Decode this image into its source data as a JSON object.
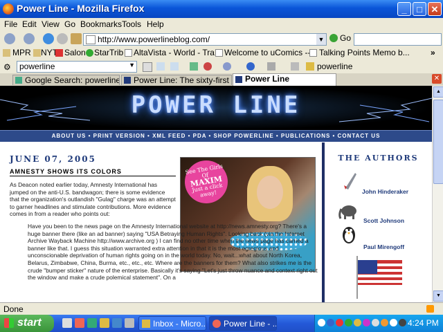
{
  "window": {
    "title": "Power Line - Mozilla Firefox",
    "min": "_",
    "max": "□",
    "close": "✕"
  },
  "menus": [
    "File",
    "Edit",
    "View",
    "Go",
    "Bookmarks",
    "Tools",
    "Help"
  ],
  "nav": {
    "url": "http://www.powerlineblog.com/",
    "go_label": "Go"
  },
  "bookmarks": [
    "MPR",
    "NYT",
    "Salon",
    "StarTrib",
    "AltaVista - World - Tra...",
    "Welcome to uComics --...",
    "Talking Points Memo b..."
  ],
  "google_bar": {
    "search_value": "powerline",
    "highlight_label": "powerline"
  },
  "tabs": [
    {
      "label": "Google Search: powerline",
      "active": false
    },
    {
      "label": "Power Line: The sixty-first ...",
      "active": false
    },
    {
      "label": "Power Line",
      "active": true
    }
  ],
  "site": {
    "logo": "POWER LINE",
    "nav": "ABOUT US • PRINT VERSION • XML FEED • PDA • SHOP POWERLINE • PUBLICATIONS • CONTACT US",
    "date": "JUNE 07, 2005",
    "post_title": "AMNESTY SHOWS ITS COLORS",
    "para1": "As Deacon noted earlier today, Amnesty International has jumped on the anti-U.S. bandwagon; there is some evidence that the organization's outlandish \"Gulag\" charge was an attempt to garner headlines and stimulate contributions. More evidence comes in from a reader who points out:",
    "para2": "Have you been to the news page on the Amnesty International website at http://news.amnesty.org? There's a huge banner there (like an ad banner) saying \"USA Betraying Human Rights\". Looking back (via the Internet Archive Wayback Machine http://www.archive.org ) I can find no other time when the news page has carried a banner like that. I guess this situation warranted extra attention in that it is the most egregious and unconscionable deprivation of human rights going on in the world today. No, wait...what about North Korea, Belarus, Zimbabwe, China, Burma, etc., etc., etc. Where are the banners for them? What also strikes me is the crude \"bumper sticker\" nature of the enterprise. Basically it's saying \"Let's just throw nuance and context right out the window and make a crude polemical statement\". On a",
    "ad_bubble_top": "See The Girls Of",
    "ad_brand": "MAXIM",
    "ad_bubble_bottom": "Just a click away!",
    "authors_title": "THE AUTHORS",
    "authors": [
      "John Hinderaker",
      "Scott Johnson",
      "Paul Mirengoff"
    ]
  },
  "status": "Done",
  "taskbar": {
    "start": "start",
    "tasks": [
      "Inbox - Micro...",
      "Power Line - ..."
    ],
    "clock": "4:24 PM"
  },
  "colors": {
    "xp_blue": "#0a55d8",
    "site_navy": "#2d4a8a",
    "date_blue": "#1f3a7a"
  }
}
